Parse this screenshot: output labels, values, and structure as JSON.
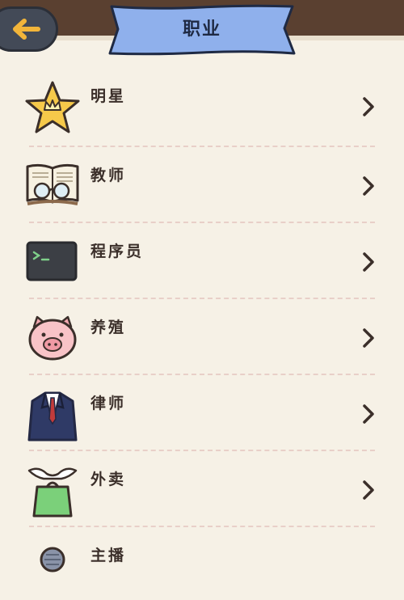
{
  "header": {
    "title": "职业",
    "back_icon": "back-arrow-icon"
  },
  "colors": {
    "background": "#f6f1e6",
    "topbar": "#5a4030",
    "banner": "#8fb0ec",
    "text": "#3b2f2a"
  },
  "professions": [
    {
      "label": "明星",
      "icon": "star-crown-icon"
    },
    {
      "label": "教师",
      "icon": "book-glasses-icon"
    },
    {
      "label": "程序员",
      "icon": "terminal-icon"
    },
    {
      "label": "养殖",
      "icon": "pig-icon"
    },
    {
      "label": "律师",
      "icon": "suit-icon"
    },
    {
      "label": "外卖",
      "icon": "delivery-bag-icon"
    },
    {
      "label": "主播",
      "icon": "streamer-icon"
    }
  ]
}
